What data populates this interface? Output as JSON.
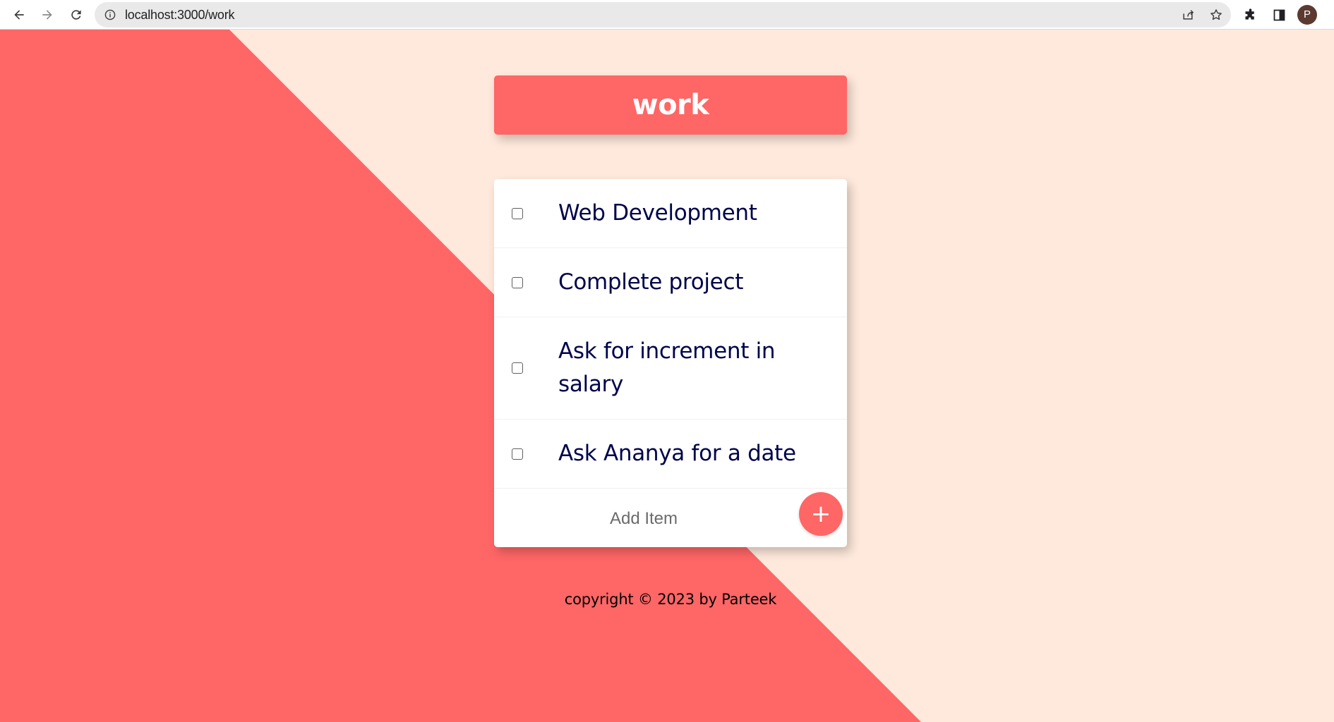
{
  "browser": {
    "url": "localhost:3000/work",
    "profile_initial": "P"
  },
  "colors": {
    "accent": "#ff6666",
    "background": "#ffe9dc",
    "item_text": "#00044a"
  },
  "heading": {
    "title": "work"
  },
  "todo": {
    "items": [
      {
        "text": "Web Development",
        "checked": false
      },
      {
        "text": "Complete project",
        "checked": false
      },
      {
        "text": "Ask for increment in salary",
        "checked": false
      },
      {
        "text": "Ask Ananya for a date",
        "checked": false
      }
    ],
    "new_item_placeholder": "Add Item",
    "add_button_label": "+"
  },
  "footer": {
    "text": "copyright © 2023 by Parteek"
  }
}
